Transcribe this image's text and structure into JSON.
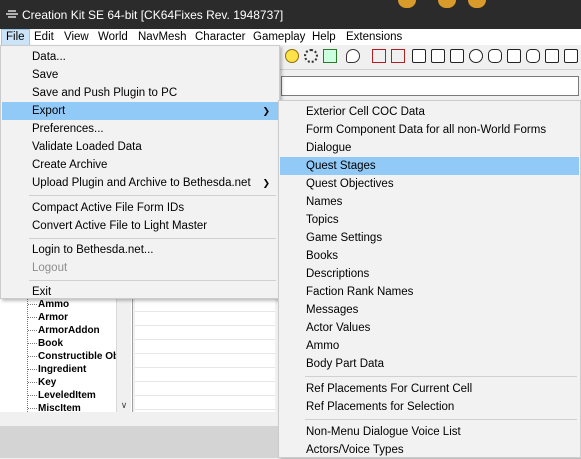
{
  "window": {
    "title": "Creation Kit SE 64-bit [CK64Fixes Rev. 1948737]",
    "icon": "creation-kit-icon"
  },
  "menubar": [
    "File",
    "Edit",
    "View",
    "World",
    "NavMesh",
    "Character",
    "Gameplay",
    "Help",
    "Extensions"
  ],
  "file_menu": {
    "items": [
      "Data...",
      "Save",
      "Save and Push Plugin to PC",
      "Export",
      "Preferences...",
      "Validate Loaded Data",
      "Create Archive",
      "Upload Plugin and Archive to Bethesda.net",
      "Compact Active File Form IDs",
      "Convert Active File to Light Master",
      "Login to Bethesda.net...",
      "Logout",
      "Exit"
    ],
    "highlighted": "Export",
    "disabled": "Logout"
  },
  "export_submenu": {
    "items": [
      "Exterior Cell COC Data",
      "Form Component Data for all non-World Forms",
      "Dialogue",
      "Quest Stages",
      "Quest Objectives",
      "Names",
      "Topics",
      "Game Settings",
      "Books",
      "Descriptions",
      "Faction Rank Names",
      "Messages",
      "Actor Values",
      "Ammo",
      "Body Part Data",
      "Ref Placements For Current Cell",
      "Ref Placements for Selection",
      "Non-Menu Dialogue Voice List",
      "Actors/Voice Types"
    ],
    "highlighted": "Quest Stages"
  },
  "object_tree": [
    "Ammo",
    "Armor",
    "ArmorAddon",
    "Book",
    "Constructible Ob",
    "Ingredient",
    "Key",
    "LeveledItem",
    "MiscItem"
  ],
  "toolbar_icons": [
    "lightbulb-icon",
    "gear-icon",
    "chart-icon",
    "speech-bubble-icon",
    "red-marker-icon",
    "red-arrows-icon",
    "box-icon",
    "box-icon",
    "box-icon",
    "circle-icon",
    "rounded-box-icon",
    "box-icon",
    "rounded-box-icon",
    "box-icon",
    "box-icon",
    "box-icon"
  ],
  "colors": {
    "highlight": "#91c9f7",
    "titlebar": "#2b2b2b",
    "menubar_active": "#cce4f7"
  }
}
